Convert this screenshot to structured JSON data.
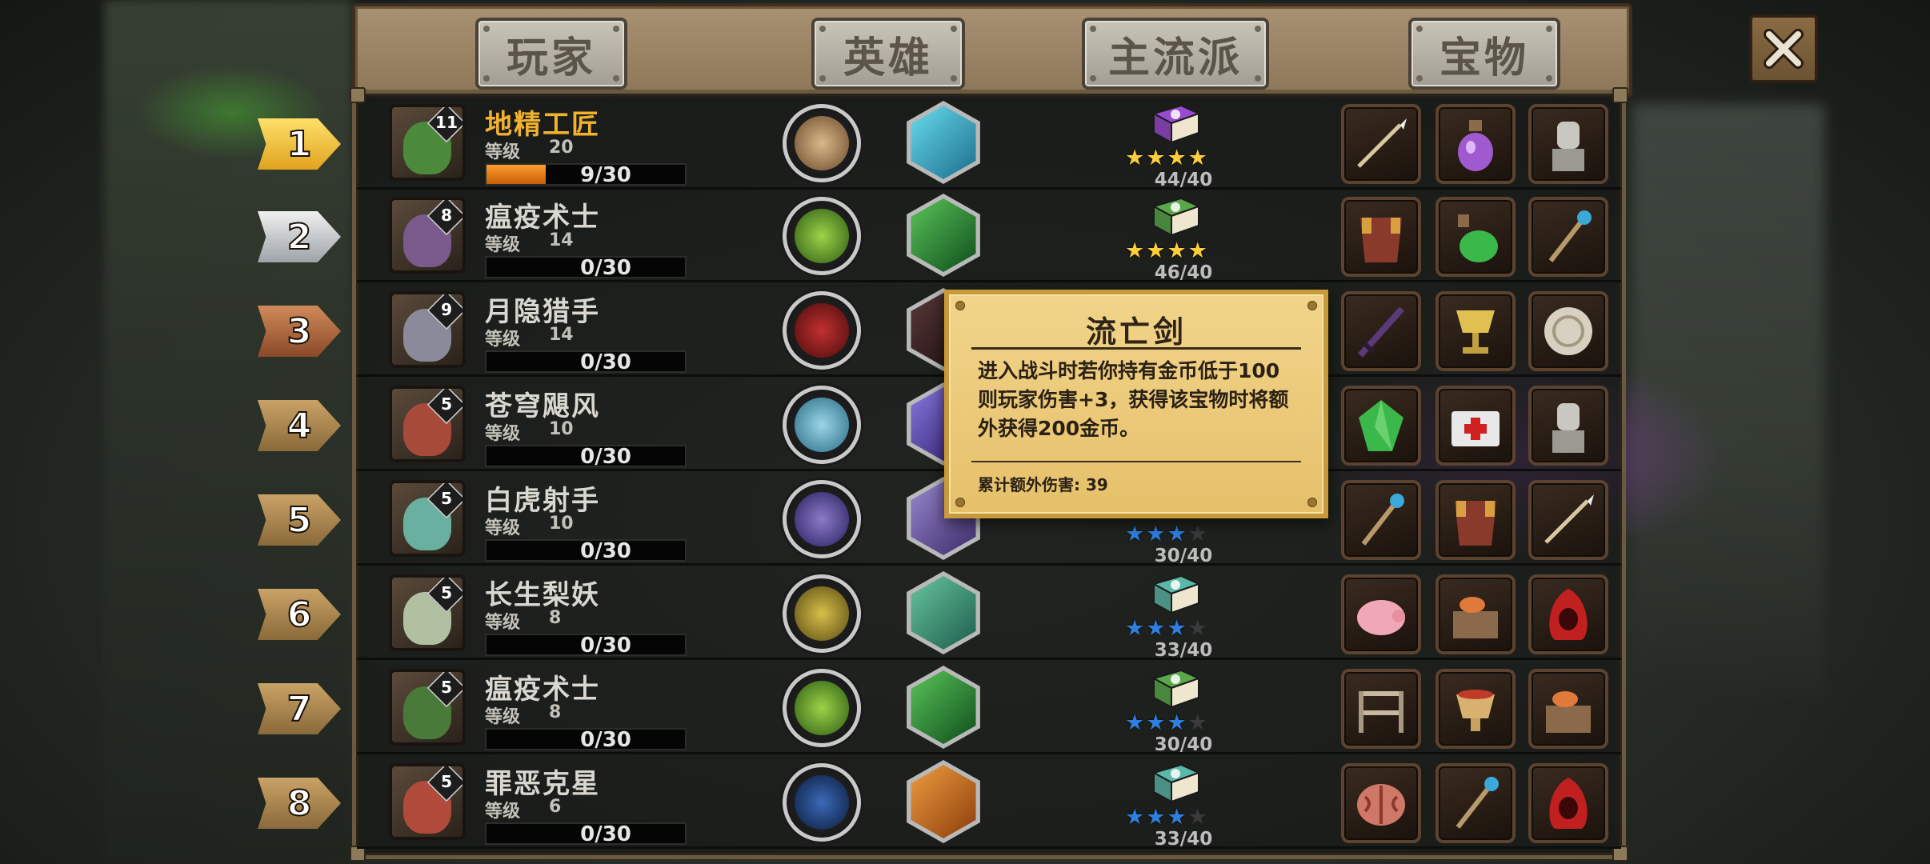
{
  "tabs": [
    {
      "label": "玩家"
    },
    {
      "label": "英雄"
    },
    {
      "label": "主流派"
    },
    {
      "label": "宝物"
    }
  ],
  "level_label": "等级",
  "rows": [
    {
      "rank": "1",
      "tier": "11",
      "name": "地精工匠",
      "level": "20",
      "xp": "9/30",
      "xp_fraction": 0.3,
      "score": "44/40",
      "stars_filled": 4,
      "star_color": "gold",
      "book": "purple",
      "skill_circle": "gear",
      "skill_hex": "cyan",
      "items": [
        "spear",
        "potion",
        "statue"
      ]
    },
    {
      "rank": "2",
      "tier": "8",
      "name": "瘟疫术士",
      "level": "14",
      "xp": "0/30",
      "xp_fraction": 0.0,
      "score": "46/40",
      "stars_filled": 4,
      "star_color": "gold",
      "book": "green",
      "skill_circle": "green-bulb",
      "skill_hex": "green",
      "items": [
        "armor",
        "green-potion",
        "staff"
      ]
    },
    {
      "rank": "3",
      "tier": "9",
      "name": "月隐猎手",
      "level": "14",
      "xp": "0/30",
      "xp_fraction": 0.0,
      "score": "",
      "stars_filled": 0,
      "star_color": "gold",
      "book": "none",
      "skill_circle": "red-axe",
      "skill_hex": "dark",
      "items": [
        "dark-sword",
        "golden-cup",
        "coin-disc"
      ]
    },
    {
      "rank": "4",
      "tier": "5",
      "name": "苍穹飓风",
      "level": "10",
      "xp": "0/30",
      "xp_fraction": 0.0,
      "score": "",
      "stars_filled": 0,
      "star_color": "gold",
      "book": "none",
      "skill_circle": "blue-swirl",
      "skill_hex": "purple",
      "items": [
        "green-gem",
        "medkit",
        "statue"
      ]
    },
    {
      "rank": "5",
      "tier": "5",
      "name": "白虎射手",
      "level": "10",
      "xp": "0/30",
      "xp_fraction": 0.0,
      "score": "30/40",
      "stars_filled": 3,
      "star_color": "blue",
      "book": "none",
      "skill_circle": "arrows",
      "skill_hex": "violet",
      "items": [
        "staff",
        "armor",
        "spear"
      ]
    },
    {
      "rank": "6",
      "tier": "5",
      "name": "长生梨妖",
      "level": "8",
      "xp": "0/30",
      "xp_fraction": 0.0,
      "score": "33/40",
      "stars_filled": 3,
      "star_color": "blue",
      "book": "teal",
      "skill_circle": "pear",
      "skill_hex": "pear",
      "items": [
        "piggy-bank",
        "meat-crate",
        "red-hood"
      ]
    },
    {
      "rank": "7",
      "tier": "5",
      "name": "瘟疫术士",
      "level": "8",
      "xp": "0/30",
      "xp_fraction": 0.0,
      "score": "30/40",
      "stars_filled": 3,
      "star_color": "blue",
      "book": "green",
      "skill_circle": "green-bulb",
      "skill_hex": "green",
      "items": [
        "shelf",
        "meat-cup",
        "meat-crate"
      ]
    },
    {
      "rank": "8",
      "tier": "5",
      "name": "罪恶克星",
      "level": "6",
      "xp": "0/30",
      "xp_fraction": 0.0,
      "score": "33/40",
      "stars_filled": 3,
      "star_color": "blue",
      "book": "teal",
      "skill_circle": "blue-star",
      "skill_hex": "orange-burst",
      "items": [
        "brain",
        "staff",
        "red-hood"
      ]
    }
  ],
  "tooltip": {
    "title": "流亡剑",
    "body": "进入战斗时若你持有金币低于100则玩家伤害+3，获得该宝物时将额外获得200金币。",
    "footer": "累计额外伤害: 39"
  },
  "colors": {
    "accent_gold": "#f2b230",
    "xp_orange": "#ff9d2e",
    "tooltip_bg": "#f1d48a",
    "star_gold": "#ffce3a",
    "star_blue": "#2f7fe0"
  }
}
